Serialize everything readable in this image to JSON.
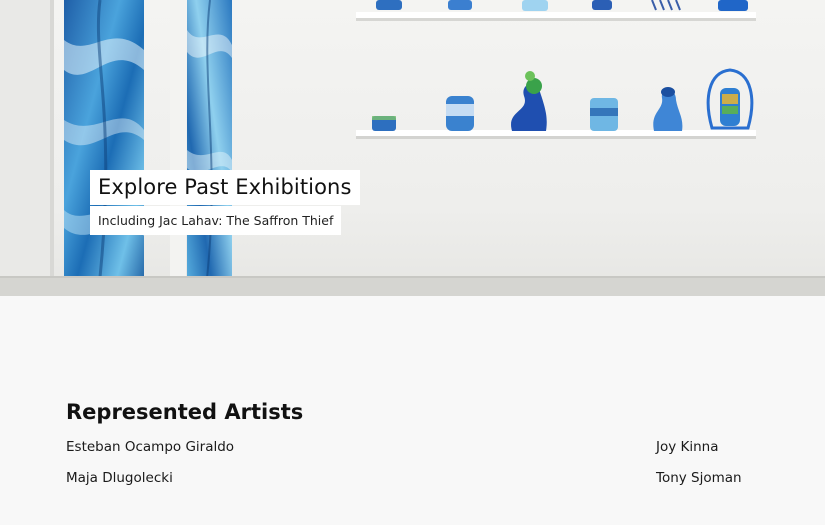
{
  "hero": {
    "title": "Explore Past Exhibitions",
    "subtitle": "Including Jac Lahav: The Saffron Thief"
  },
  "represented": {
    "heading": "Represented Artists",
    "left_column": [
      "Esteban Ocampo Giraldo",
      "Maja Dlugolecki"
    ],
    "right_column": [
      "Joy Kinna",
      "Tony Sjoman"
    ]
  },
  "colors": {
    "page_background": "#f8f8f8",
    "wall": "#f1f1ef",
    "painting_blue": "#2f7fc4",
    "shelf": "#ffffff",
    "text": "#111111"
  }
}
